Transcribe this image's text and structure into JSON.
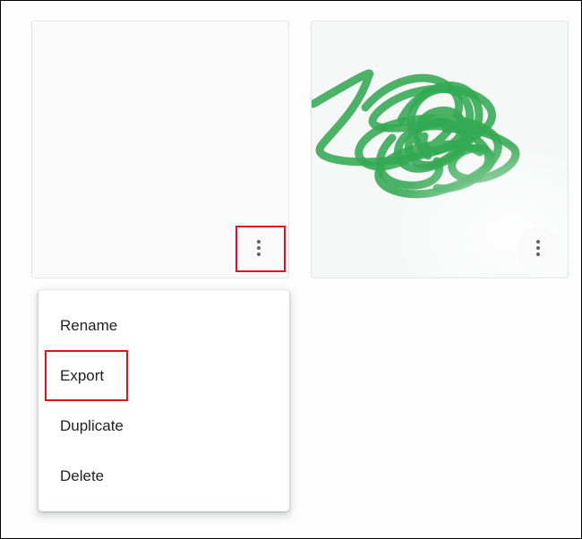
{
  "cards": [
    {
      "more_icon": "more-vert-icon"
    },
    {
      "more_icon": "more-vert-icon",
      "drawing": "green-scribble",
      "drawing_color": "#34a853"
    }
  ],
  "menu": {
    "items": [
      {
        "label": "Rename"
      },
      {
        "label": "Export"
      },
      {
        "label": "Duplicate"
      },
      {
        "label": "Delete"
      }
    ]
  },
  "colors": {
    "highlight": "#e0121b",
    "scribble": "#34a853",
    "icon": "#5f6368",
    "text": "#202124"
  }
}
